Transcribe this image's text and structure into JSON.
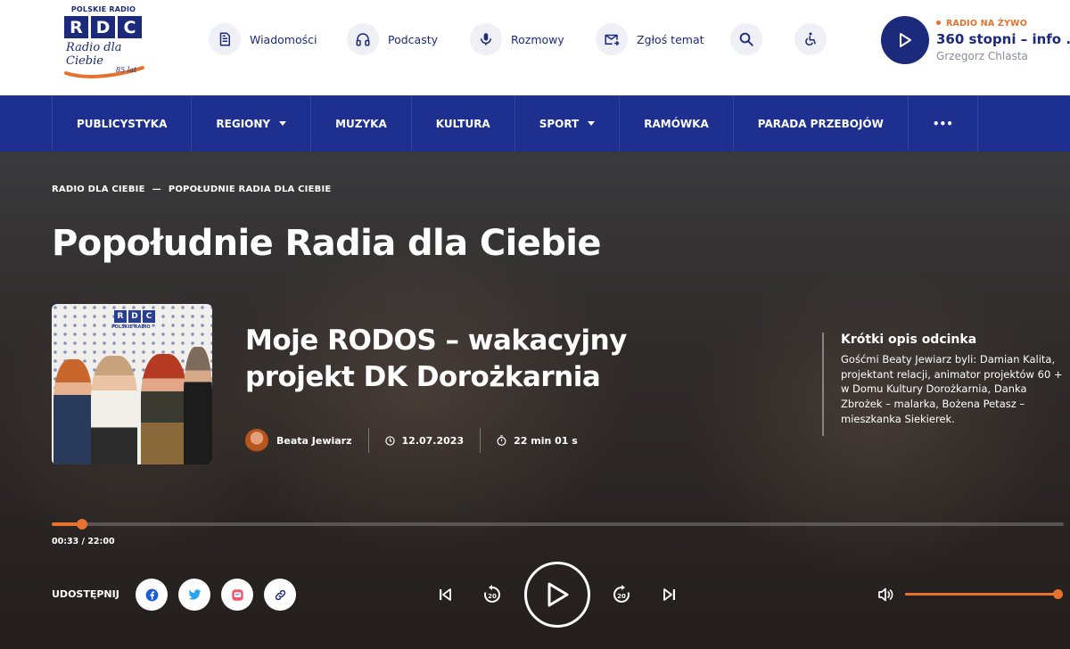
{
  "header": {
    "logo": {
      "top": "POLSKIE RADIO",
      "letters": [
        "R",
        "D",
        "C"
      ],
      "script": "Radio dla Ciebie",
      "badge": "85 lat"
    },
    "nav": [
      {
        "label": "Wiadomości",
        "icon": "document-icon"
      },
      {
        "label": "Podcasty",
        "icon": "headphones-icon"
      },
      {
        "label": "Rozmowy",
        "icon": "microphone-icon"
      },
      {
        "label": "Zgłoś temat",
        "icon": "mail-send-icon"
      }
    ],
    "search_icon": "search-icon",
    "accessibility_icon": "wheelchair-icon",
    "live": {
      "tag": "RADIO NA ŻYWO",
      "title": "360 stopni – info ...",
      "host": "Grzegorz Chlasta"
    }
  },
  "menu": [
    {
      "label": "PUBLICYSTYKA",
      "dropdown": false
    },
    {
      "label": "REGIONY",
      "dropdown": true
    },
    {
      "label": "MUZYKA",
      "dropdown": false
    },
    {
      "label": "KULTURA",
      "dropdown": false
    },
    {
      "label": "SPORT",
      "dropdown": true
    },
    {
      "label": "RAMÓWKA",
      "dropdown": false
    },
    {
      "label": "PARADA PRZEBOJÓW",
      "dropdown": false
    },
    {
      "label": "•••",
      "dropdown": false
    }
  ],
  "breadcrumb": {
    "items": [
      "RADIO DLA CIEBIE",
      "POPOŁUDNIE RADIA DLA CIEBIE"
    ],
    "separator": "—"
  },
  "page_title": "Popołudnie Radia dla Ciebie",
  "thumbnail": {
    "letters": [
      "R",
      "D",
      "C"
    ],
    "caption": "POLSKIE RADIO"
  },
  "episode": {
    "title": "Moje RODOS – wakacyjny projekt DK Dorożkarnia",
    "author": "Beata Jewiarz",
    "date": "12.07.2023",
    "duration": "22 min 01 s"
  },
  "description": {
    "heading": "Krótki opis odcinka",
    "text": "Gośćmi Beaty Jewiarz byli: Damian Kalita, projektant relacji, animator projektów 60 + w Domu Kultury Dorożkarnia, Danka Zbrożek – malarka, Bożena Petasz – mieszkanka Siekierek."
  },
  "player": {
    "time": "00:33 / 22:00",
    "progress_fraction": 0.03,
    "volume_fraction": 1.0,
    "skip_back_seconds": "20",
    "skip_forward_seconds": "20"
  },
  "share": {
    "label": "UDOSTĘPNIJ",
    "buttons": [
      "facebook-icon",
      "twitter-icon",
      "messenger-icon",
      "link-icon"
    ]
  },
  "colors": {
    "brand_blue": "#1d2f8f",
    "accent_orange": "#e5722e",
    "text_dark_blue": "#1b2a7a"
  }
}
